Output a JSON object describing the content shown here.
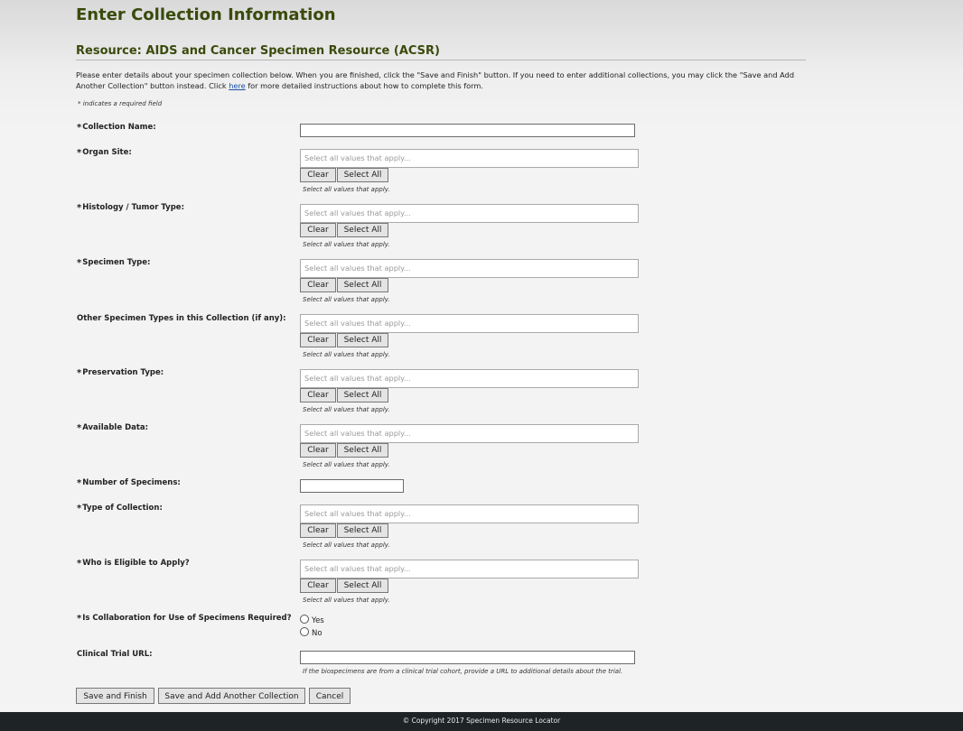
{
  "page": {
    "title": "Enter Collection Information",
    "resource_heading": "Resource: AIDS and Cancer Specimen Resource (ACSR)",
    "intro_part1": "Please enter details about your specimen collection below. When you are finished, click the \"Save and Finish\" button. If you need to enter additional collections, you may click the \"Save and Add Another Collection\" button instead. Click ",
    "intro_link": "here",
    "intro_part2": " for more detailed instructions about how to complete this form.",
    "required_note": "* indicates a required field"
  },
  "common": {
    "required_star": "*",
    "multi_placeholder": "Select all values that apply...",
    "clear_label": "Clear",
    "select_all_label": "Select All",
    "multi_hint": "Select all values that apply."
  },
  "fields": {
    "collection_name": {
      "label": "Collection Name:",
      "value": ""
    },
    "organ_site": {
      "label": "Organ Site:"
    },
    "histology": {
      "label": "Histology / Tumor Type:"
    },
    "specimen_type": {
      "label": "Specimen Type:"
    },
    "other_specimen_types": {
      "label": "Other Specimen Types in this Collection (if any):"
    },
    "preservation_type": {
      "label": "Preservation Type:"
    },
    "available_data": {
      "label": "Available Data:"
    },
    "number_of_specimens": {
      "label": "Number of Specimens:",
      "value": ""
    },
    "type_of_collection": {
      "label": "Type of Collection:"
    },
    "who_is_eligible": {
      "label": "Who is Eligible to Apply?"
    },
    "collaboration_required": {
      "label": "Is Collaboration for Use of Specimens Required?",
      "options": [
        "Yes",
        "No"
      ],
      "selected": null
    },
    "clinical_trial_url": {
      "label": "Clinical Trial URL:",
      "value": "",
      "hint": "If the biospecimens are from a clinical trial cohort, provide a URL to additional details about the trial."
    }
  },
  "actions": {
    "save_finish": "Save and Finish",
    "save_add": "Save and Add Another Collection",
    "cancel": "Cancel"
  },
  "footer": {
    "text": "© Copyright 2017 Specimen Resource Locator"
  },
  "colors": {
    "heading": "#3a4a0c",
    "footer_bg": "#1e2426",
    "link": "#1a4fa8"
  }
}
